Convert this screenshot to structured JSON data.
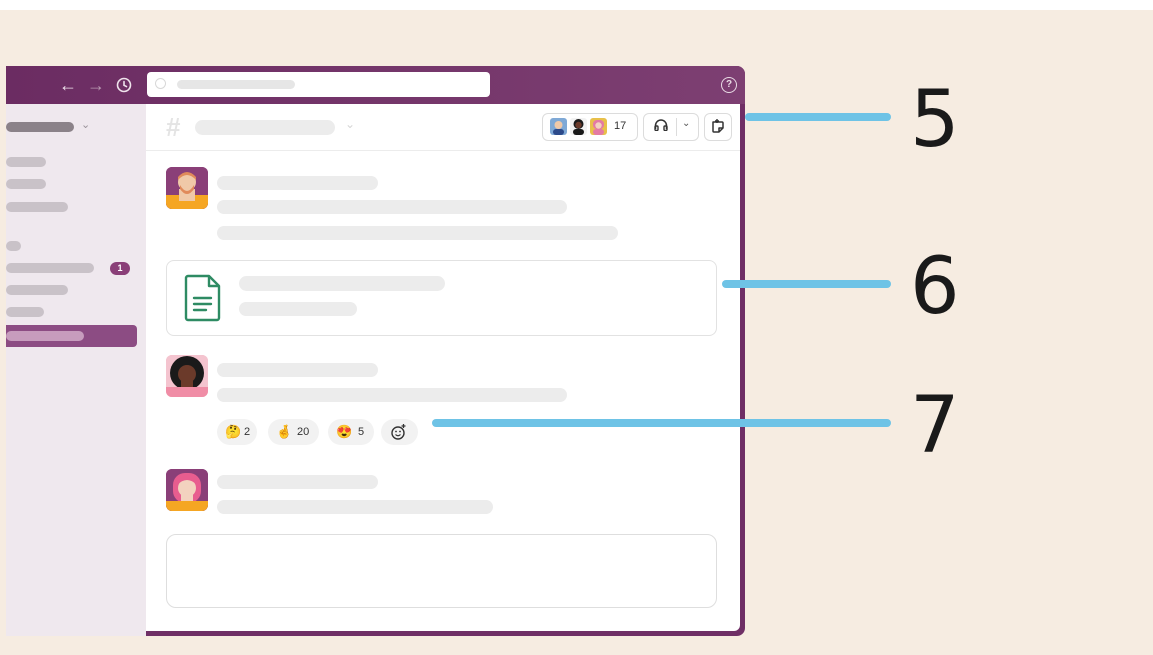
{
  "header": {
    "member_count": "17",
    "help_glyph": "?"
  },
  "sidebar": {
    "unread_badge": "1"
  },
  "reactions": [
    {
      "emoji": "🤔",
      "count": "2"
    },
    {
      "emoji": "🤞",
      "count": "20"
    },
    {
      "emoji": "😍",
      "count": "5"
    }
  ],
  "callouts": [
    "5",
    "6",
    "7"
  ],
  "colors": {
    "aubergine": "#6f2f66",
    "sidebar_active": "#8c4c83",
    "callout_line": "#6ec3e6",
    "canvas_green": "#2e8b63",
    "background": "#f6ece1"
  },
  "icons": {
    "back": "arrow-left-icon",
    "forward": "arrow-right-icon",
    "history": "clock-icon",
    "search": "search-icon",
    "help": "help-circle-icon",
    "huddle": "headphones-icon",
    "canvas": "canvas-icon",
    "document": "document-icon",
    "add_reaction": "add-reaction-icon"
  }
}
